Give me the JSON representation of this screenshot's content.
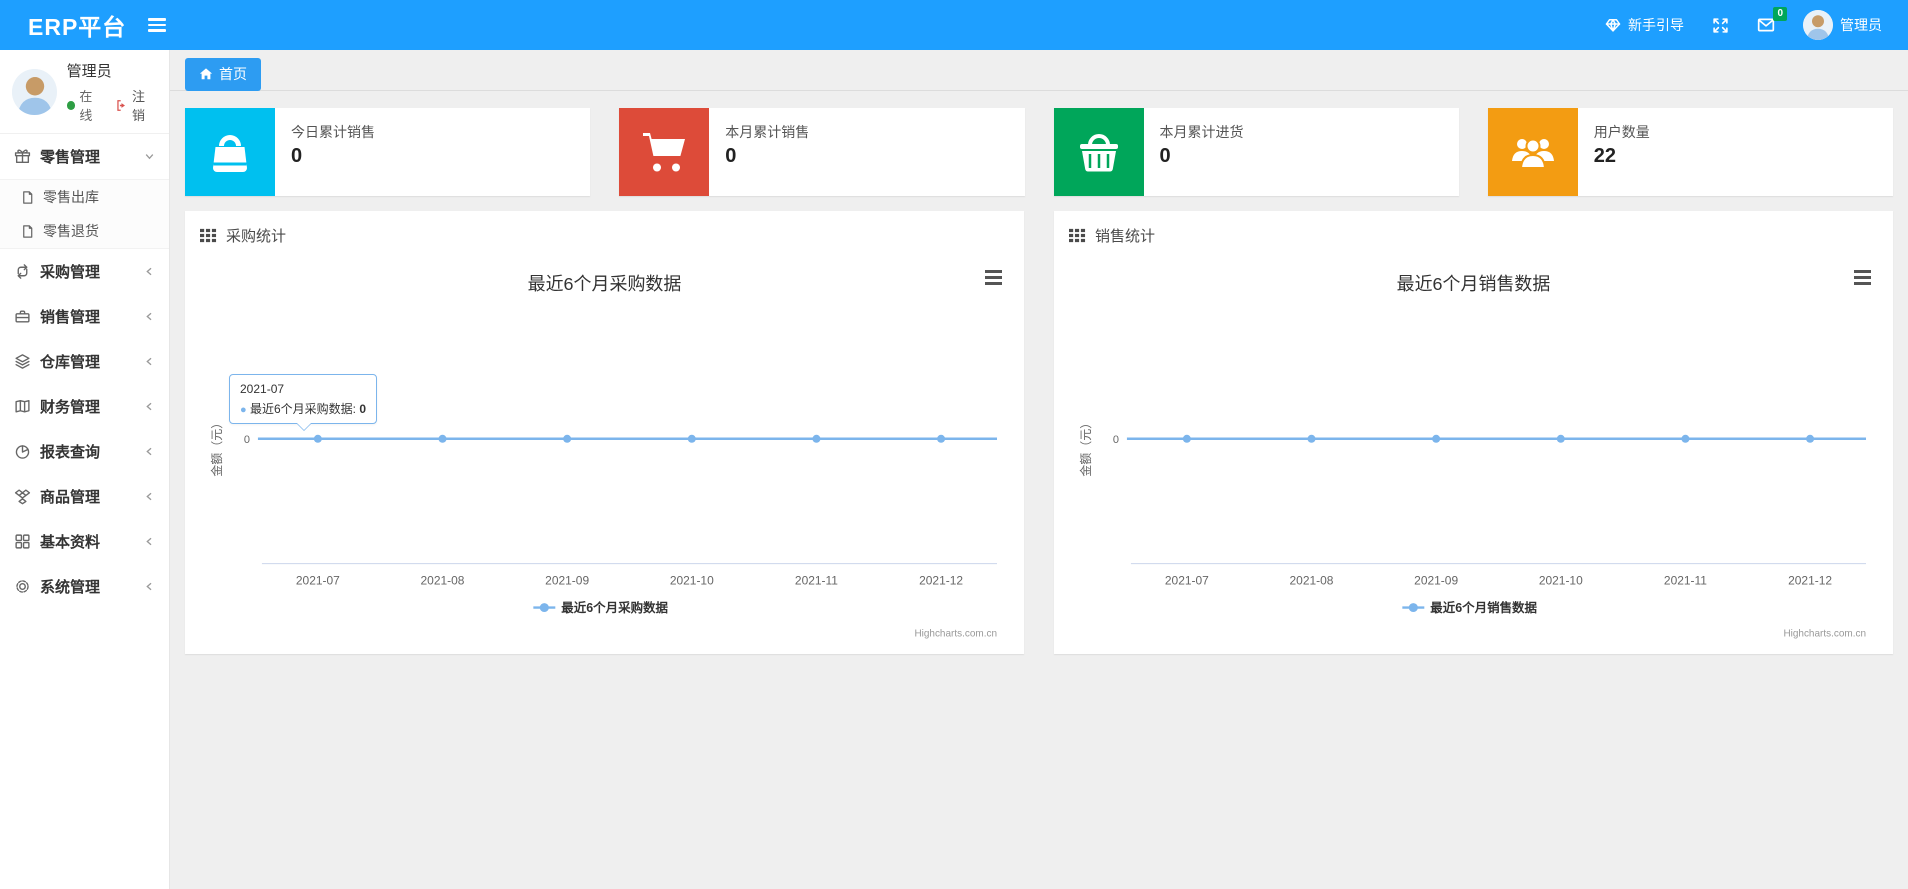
{
  "navbar": {
    "brand": "ERP平台",
    "guide_label": "新手引导",
    "message_badge": "0",
    "username": "管理员"
  },
  "sidebar": {
    "user": {
      "name": "管理员",
      "status": "在线",
      "logout_label": "注销"
    },
    "menu": [
      {
        "label": "零售管理",
        "icon": "gift-icon",
        "state": "expanded",
        "children": [
          {
            "label": "零售出库"
          },
          {
            "label": "零售退货"
          }
        ]
      },
      {
        "label": "采购管理",
        "icon": "repeat-icon"
      },
      {
        "label": "销售管理",
        "icon": "briefcase-icon"
      },
      {
        "label": "仓库管理",
        "icon": "layers-icon"
      },
      {
        "label": "财务管理",
        "icon": "ledger-icon"
      },
      {
        "label": "报表查询",
        "icon": "pie-chart-icon"
      },
      {
        "label": "商品管理",
        "icon": "box-icon"
      },
      {
        "label": "基本资料",
        "icon": "grid-icon"
      },
      {
        "label": "系统管理",
        "icon": "gear-icon"
      }
    ]
  },
  "tabs": {
    "home": "首页"
  },
  "stat_cards": [
    {
      "label": "今日累计销售",
      "value": "0",
      "color": "#00c0ef",
      "icon": "shopping-bag-icon"
    },
    {
      "label": "本月累计销售",
      "value": "0",
      "color": "#dd4b39",
      "icon": "shopping-cart-icon"
    },
    {
      "label": "本月累计进货",
      "value": "0",
      "color": "#00a65a",
      "icon": "shopping-basket-icon"
    },
    {
      "label": "用户数量",
      "value": "22",
      "color": "#f39c12",
      "icon": "users-icon"
    }
  ],
  "chart_data": [
    {
      "type": "line",
      "panel_title": "采购统计",
      "title": "最近6个月采购数据",
      "x": [
        "2021-07",
        "2021-08",
        "2021-09",
        "2021-10",
        "2021-11",
        "2021-12"
      ],
      "series": [
        {
          "name": "最近6个月采购数据",
          "values": [
            0,
            0,
            0,
            0,
            0,
            0
          ],
          "color": "#7cb5ec"
        }
      ],
      "ylabel": "金额（元）",
      "ytick": "0",
      "ylim": [
        0,
        0
      ],
      "grid": false,
      "legend_position": "bottom",
      "credits": "Highcharts.com.cn",
      "tooltip": {
        "visible": true,
        "header": "2021-07",
        "label": "最近6个月采购数据:",
        "value": "0"
      }
    },
    {
      "type": "line",
      "panel_title": "销售统计",
      "title": "最近6个月销售数据",
      "x": [
        "2021-07",
        "2021-08",
        "2021-09",
        "2021-10",
        "2021-11",
        "2021-12"
      ],
      "series": [
        {
          "name": "最近6个月销售数据",
          "values": [
            0,
            0,
            0,
            0,
            0,
            0
          ],
          "color": "#7cb5ec"
        }
      ],
      "ylabel": "金额（元）",
      "ytick": "0",
      "ylim": [
        0,
        0
      ],
      "grid": false,
      "legend_position": "bottom",
      "credits": "Highcharts.com.cn",
      "tooltip": {
        "visible": false
      }
    }
  ]
}
